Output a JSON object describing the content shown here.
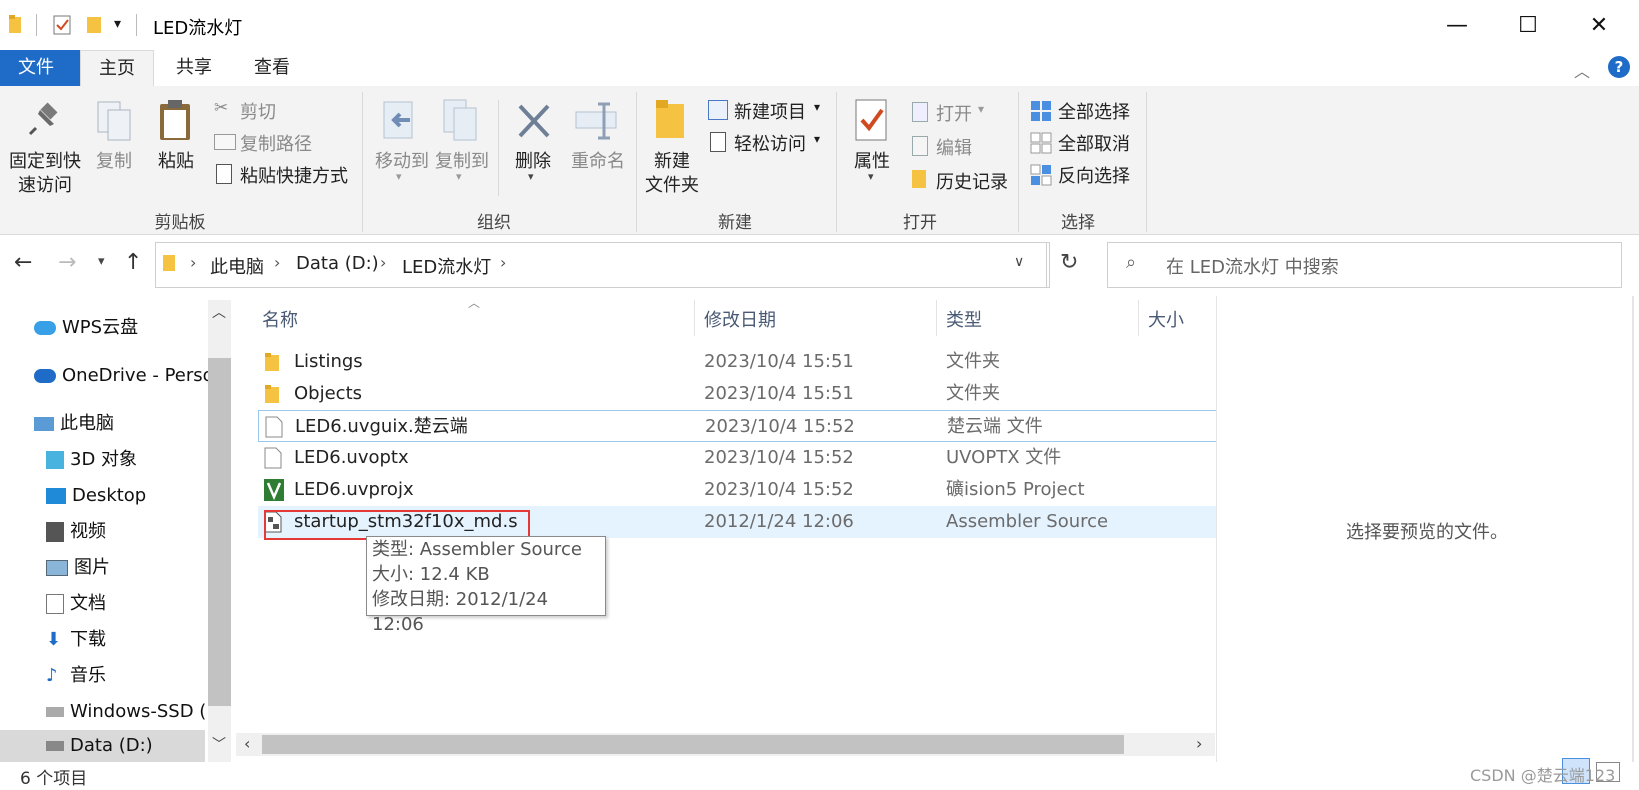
{
  "window": {
    "title": "LED流水灯",
    "minimize": "—",
    "maximize": "☐",
    "close": "✕"
  },
  "tabs": [
    {
      "label": "文件"
    },
    {
      "label": "主页"
    },
    {
      "label": "共享"
    },
    {
      "label": "查看"
    }
  ],
  "ribbon": {
    "clipboard": {
      "pin_label_1": "固定到快",
      "pin_label_2": "速访问",
      "copy_label": "复制",
      "paste_label": "粘贴",
      "cut_label": "剪切",
      "copy_path_label": "复制路径",
      "paste_shortcut_label": "粘贴快捷方式",
      "group_label": "剪贴板"
    },
    "organize": {
      "move_to_label": "移动到",
      "copy_to_label": "复制到",
      "delete_label": "删除",
      "rename_label": "重命名",
      "group_label": "组织"
    },
    "new": {
      "new_folder_label_1": "新建",
      "new_folder_label_2": "文件夹",
      "new_item_label": "新建项目",
      "easy_access_label": "轻松访问",
      "group_label": "新建"
    },
    "open": {
      "properties_label": "属性",
      "open_label": "打开",
      "edit_label": "编辑",
      "history_label": "历史记录",
      "group_label": "打开"
    },
    "select": {
      "select_all_label": "全部选择",
      "select_none_label": "全部取消",
      "invert_label": "反向选择",
      "group_label": "选择"
    }
  },
  "address": {
    "crumbs": [
      "此电脑",
      "Data (D:)",
      "LED流水灯"
    ],
    "search_placeholder": "在 LED流水灯 中搜索"
  },
  "nav": {
    "items": [
      {
        "label": "WPS云盘"
      },
      {
        "label": "OneDrive - Perso"
      },
      {
        "label": "此电脑"
      },
      {
        "label": "3D 对象"
      },
      {
        "label": "Desktop"
      },
      {
        "label": "视频"
      },
      {
        "label": "图片"
      },
      {
        "label": "文档"
      },
      {
        "label": "下载"
      },
      {
        "label": "音乐"
      },
      {
        "label": "Windows-SSD ("
      },
      {
        "label": "Data (D:)"
      }
    ]
  },
  "columns": {
    "name": "名称",
    "date": "修改日期",
    "type": "类型",
    "size": "大小"
  },
  "files": [
    {
      "name": "Listings",
      "date": "2023/10/4 15:51",
      "type": "文件夹"
    },
    {
      "name": "Objects",
      "date": "2023/10/4 15:51",
      "type": "文件夹"
    },
    {
      "name": "LED6.uvguix.楚云端",
      "date": "2023/10/4 15:52",
      "type": "楚云端 文件"
    },
    {
      "name": "LED6.uvoptx",
      "date": "2023/10/4 15:52",
      "type": "UVOPTX 文件"
    },
    {
      "name": "LED6.uvprojx",
      "date": "2023/10/4 15:52",
      "type": "礦ision5 Project"
    },
    {
      "name": "startup_stm32f10x_md.s",
      "date": "2012/1/24 12:06",
      "type": "Assembler Source"
    }
  ],
  "tooltip": {
    "type": "类型: Assembler Source",
    "size": "大小: 12.4 KB",
    "modified": "修改日期: 2012/1/24 12:06"
  },
  "preview": {
    "text": "选择要预览的文件。"
  },
  "status": {
    "count": "6 个项目",
    "watermark": "CSDN @楚云端123"
  }
}
